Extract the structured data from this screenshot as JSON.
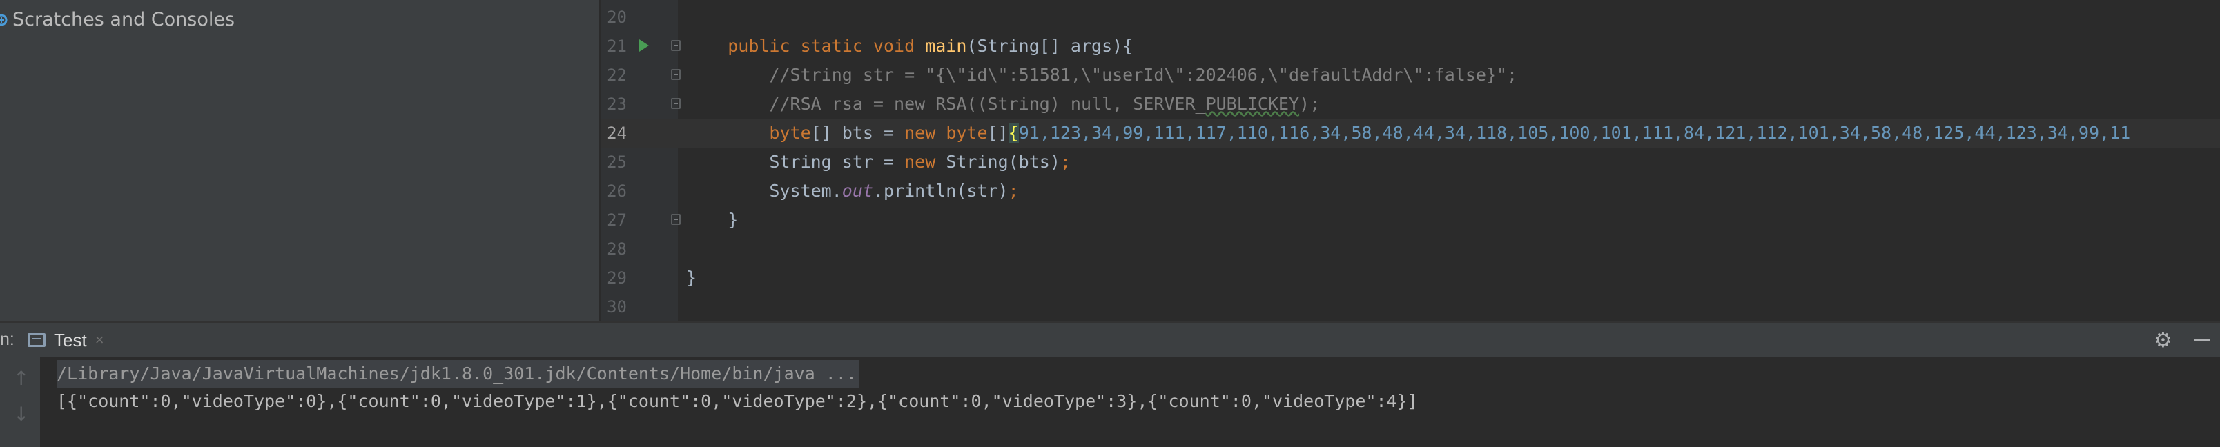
{
  "project": {
    "scratches_label": "Scratches and Consoles"
  },
  "editor": {
    "line_numbers": [
      "20",
      "21",
      "22",
      "23",
      "24",
      "25",
      "26",
      "27",
      "28",
      "29",
      "30"
    ],
    "current_line": "24",
    "lines": {
      "l21": {
        "indent": "    ",
        "kw1": "public static void ",
        "fn": "main",
        "rest": "(String[] args){"
      },
      "l22": {
        "indent": "        ",
        "comment": "//String str = \"{\\\"id\\\":51581,\\\"userId\\\":202406,\\\"defaultAddr\\\":false}\";"
      },
      "l23": {
        "indent": "        ",
        "comment_a": "//RSA rsa = new RSA((String) null, SERVER_",
        "comment_b": "PUBLICKEY",
        "comment_c": ");"
      },
      "l24": {
        "indent": "        ",
        "kw1": "byte",
        "t1": "[] bts = ",
        "kw2": "new ",
        "kw3": "byte",
        "t2": "[]",
        "brace": "{",
        "nums": "91,123,34,99,111,117,110,116,34,58,48,44,34,118,105,100,101,111,84,121,112,101,34,58,48,125,44,123,34,99,11"
      },
      "l25": {
        "indent": "        ",
        "t1": "String str = ",
        "kw1": "new ",
        "t2": "String(bts)",
        "semi": ";"
      },
      "l26": {
        "indent": "        ",
        "t1": "System.",
        "fld": "out",
        "t2": ".println(str)",
        "semi": ";"
      },
      "l27": {
        "indent": "    ",
        "t1": "}"
      },
      "l29": {
        "t1": "}"
      }
    }
  },
  "run_panel": {
    "prefix": "n:",
    "tab_label": "Test",
    "tab_close": "×",
    "gear": "⚙",
    "command_line": "/Library/Java/JavaVirtualMachines/jdk1.8.0_301.jdk/Contents/Home/bin/java ...",
    "output_line": "[{\"count\":0,\"videoType\":0},{\"count\":0,\"videoType\":1},{\"count\":0,\"videoType\":2},{\"count\":0,\"videoType\":3},{\"count\":0,\"videoType\":4}]",
    "up_arrow": "↑",
    "down_arrow": "↓"
  }
}
